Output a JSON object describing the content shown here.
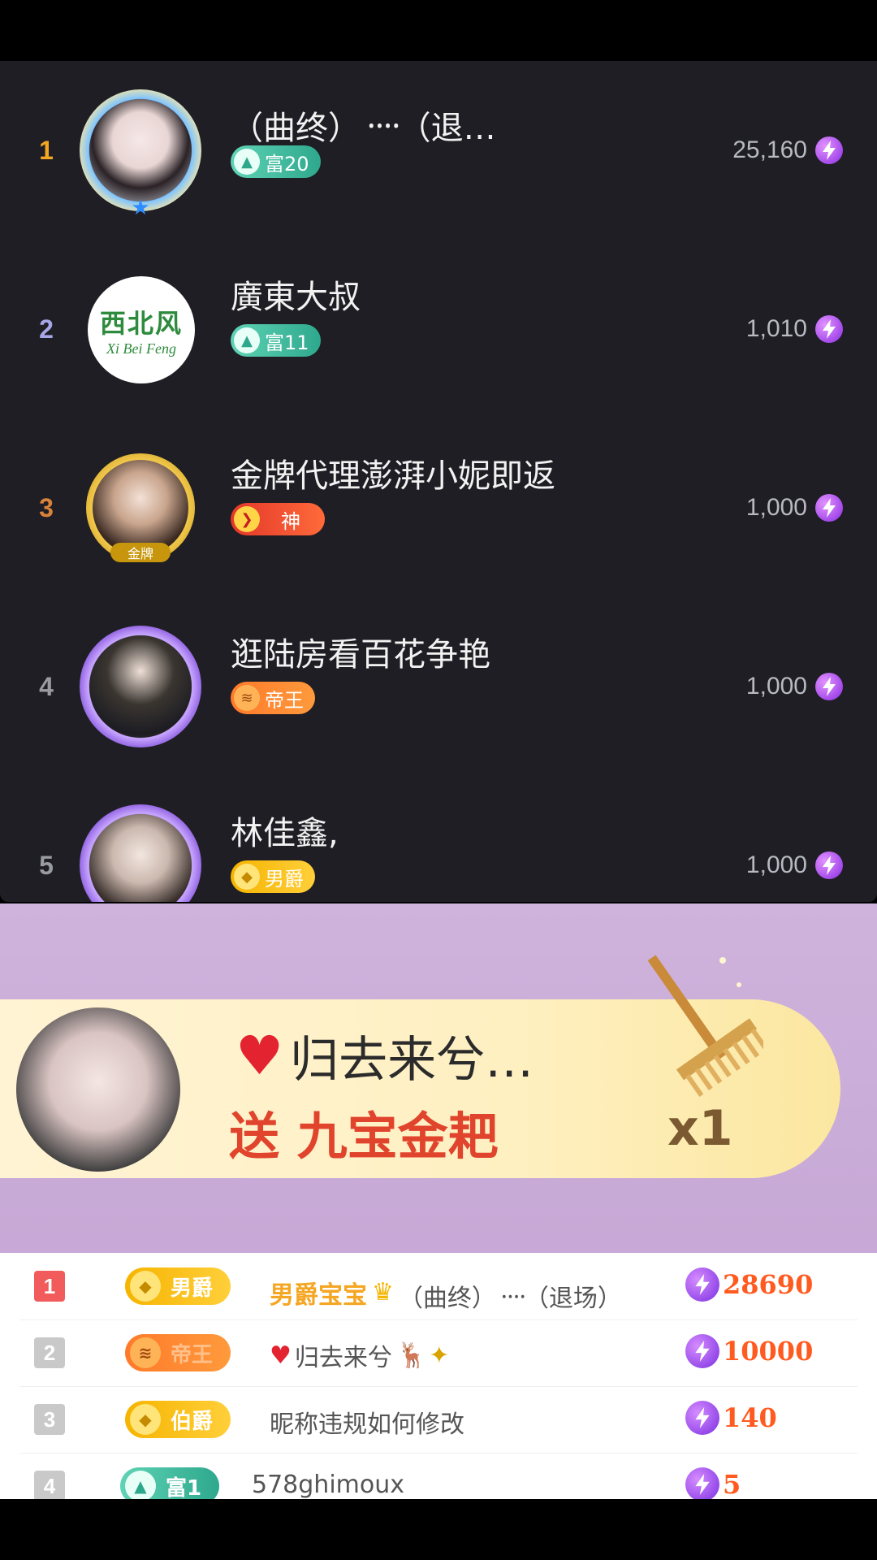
{
  "ranking": {
    "rows": [
      {
        "rank": "1",
        "name": "（曲终）᠁（退…",
        "badge": "富20",
        "score": "25,160"
      },
      {
        "rank": "2",
        "name": "廣東大叔",
        "badge": "富11",
        "score": "1,010"
      },
      {
        "rank": "3",
        "name": "金牌代理澎湃小妮即返",
        "badge": "神",
        "score": "1,000"
      },
      {
        "rank": "4",
        "name": "逛陆房看百花争艳",
        "badge": "帝王",
        "score": "1,000"
      },
      {
        "rank": "5",
        "name": "林佳鑫,",
        "badge": "男爵",
        "score": "1,000"
      }
    ],
    "avatar_texts": {
      "xibeifeng": "西北风",
      "xibeifeng_sub": "Xi Bei Feng",
      "gold_label": "金牌"
    }
  },
  "gift": {
    "user": "归去来兮…",
    "send_label": "送",
    "gift_name": "九宝金耙",
    "count": "x1"
  },
  "contributors": [
    {
      "rank": "1",
      "badge": "男爵",
      "name_highlight": "男爵宝宝",
      "name": "（曲终）᠁（退场）",
      "score": "28690"
    },
    {
      "rank": "2",
      "badge": "帝王",
      "name": "归去来兮",
      "score": "10000"
    },
    {
      "rank": "3",
      "badge": "伯爵",
      "name": "昵称违规如何修改",
      "score": "140"
    },
    {
      "rank": "4",
      "badge": "富1",
      "name": "578ghimoux",
      "score": "5"
    }
  ],
  "colors": {
    "rank1": "#f5a623",
    "rank2": "#a9a6e8",
    "rank3": "#d9823a",
    "rank_other": "#9a9aa3",
    "score_orange": "#ff5a1f",
    "gift_red": "#e0442c"
  },
  "icons": [
    "lightning-icon",
    "crown-icon",
    "heart-icon",
    "diamond-icon"
  ]
}
